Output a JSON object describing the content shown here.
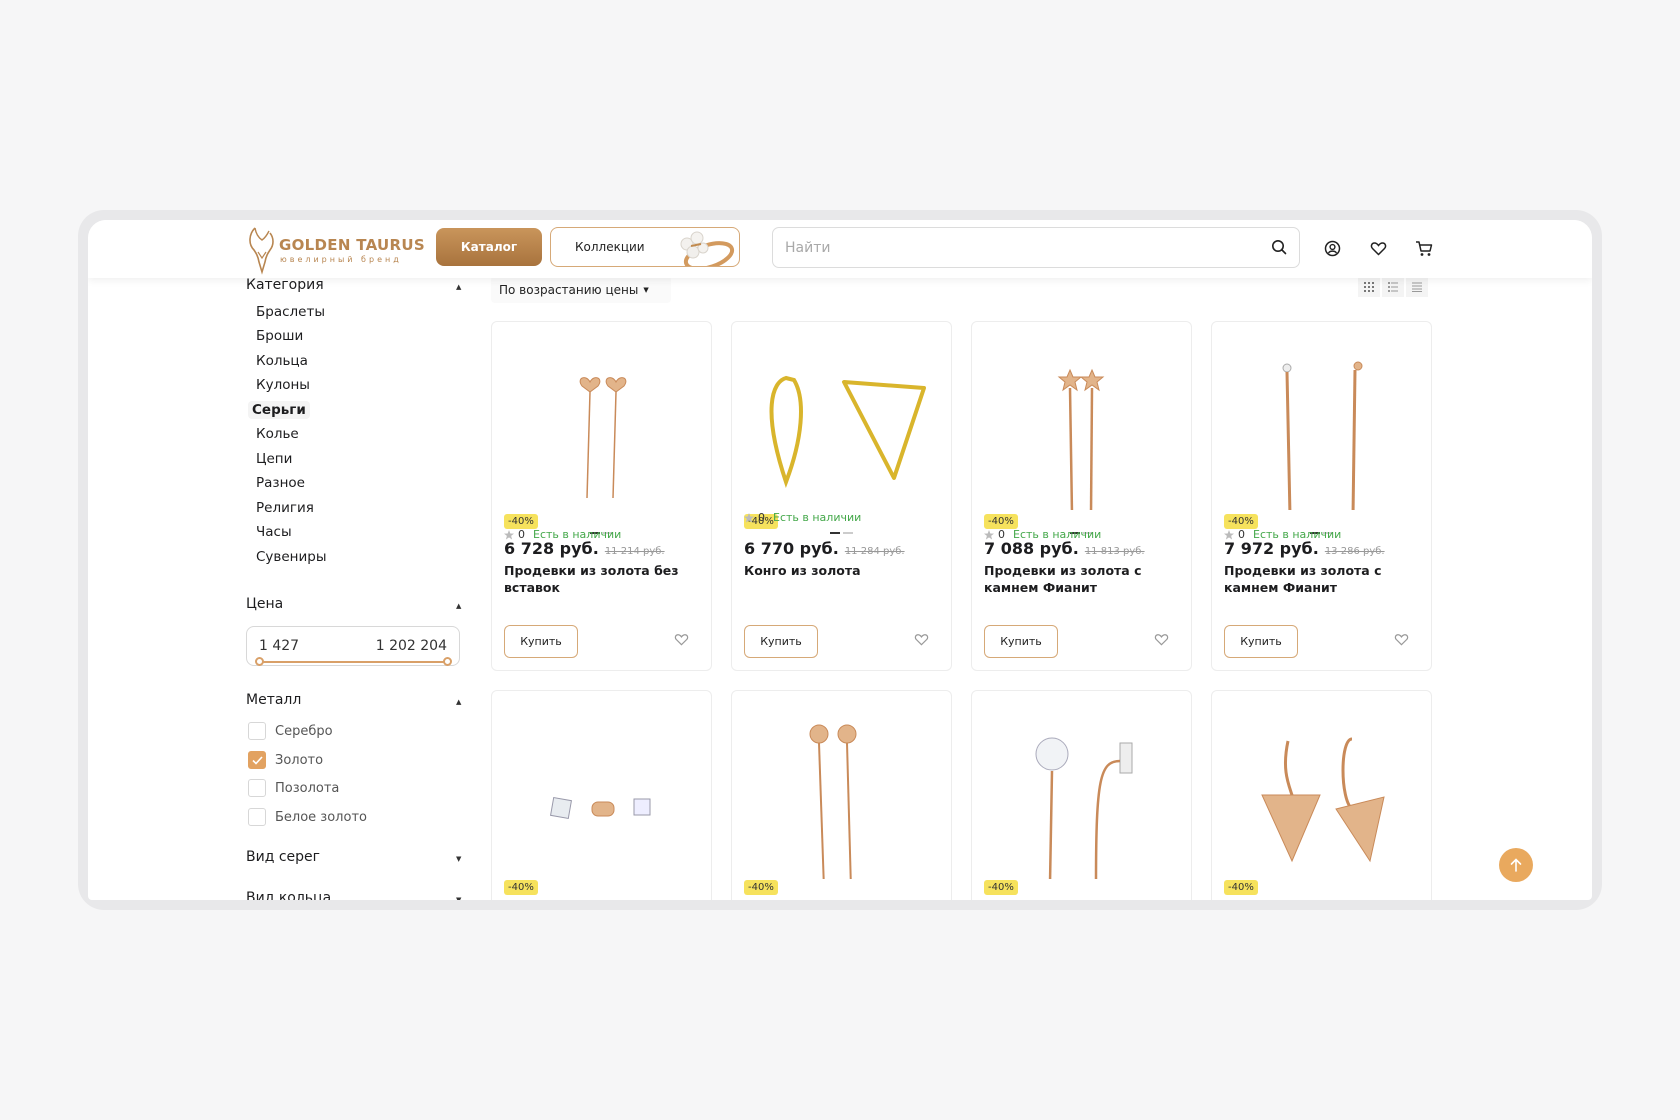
{
  "brand": {
    "name": "GOLDEN TAURUS",
    "tagline": "ювелирный бренд"
  },
  "header": {
    "catalog_label": "Каталог",
    "collections_label": "Коллекции",
    "search_placeholder": "Найти"
  },
  "sidebar": {
    "category_title": "Категория",
    "categories": [
      {
        "label": "Браслеты"
      },
      {
        "label": "Броши"
      },
      {
        "label": "Кольца"
      },
      {
        "label": "Кулоны"
      },
      {
        "label": "Серьги",
        "active": true
      },
      {
        "label": "Колье"
      },
      {
        "label": "Цепи"
      },
      {
        "label": "Разное"
      },
      {
        "label": "Религия"
      },
      {
        "label": "Часы"
      },
      {
        "label": "Сувениры"
      }
    ],
    "price_title": "Цена",
    "price_min": "1 427",
    "price_max": "1 202 204",
    "metal_title": "Металл",
    "metals": [
      {
        "label": "Серебро",
        "checked": false
      },
      {
        "label": "Золото",
        "checked": true
      },
      {
        "label": "Позолота",
        "checked": false
      },
      {
        "label": "Белое золото",
        "checked": false
      }
    ],
    "earring_type_title": "Вид серег",
    "ring_type_title": "Вид кольца"
  },
  "toolbar": {
    "sort_label": "По возрастанию цены"
  },
  "products": [
    {
      "discount": "-40%",
      "price": "6 728 руб.",
      "old_price": "11 214 руб.",
      "name": "Продевки из золота без вставок",
      "rating": "0",
      "stock": "Есть в наличии",
      "buy_label": "Купить"
    },
    {
      "discount": "-40%",
      "price": "6 770 руб.",
      "old_price": "11 284 руб.",
      "name": "Конго из золота",
      "rating": "0",
      "stock": "Есть в наличии",
      "buy_label": "Купить"
    },
    {
      "discount": "-40%",
      "price": "7 088 руб.",
      "old_price": "11 813 руб.",
      "name": "Продевки из золота с камнем Фианит",
      "rating": "0",
      "stock": "Есть в наличии",
      "buy_label": "Купить"
    },
    {
      "discount": "-40%",
      "price": "7 972 руб.",
      "old_price": "13 286 руб.",
      "name": "Продевки из золота с камнем Фианит",
      "rating": "0",
      "stock": "Есть в наличии",
      "buy_label": "Купить"
    },
    {
      "discount": "-40%"
    },
    {
      "discount": "-40%"
    },
    {
      "discount": "-40%"
    },
    {
      "discount": "-40%"
    }
  ],
  "colors": {
    "accent": "#d6a978",
    "accent_dark": "#a8733d",
    "badge": "#f6e25d",
    "stock": "#44a84a"
  }
}
